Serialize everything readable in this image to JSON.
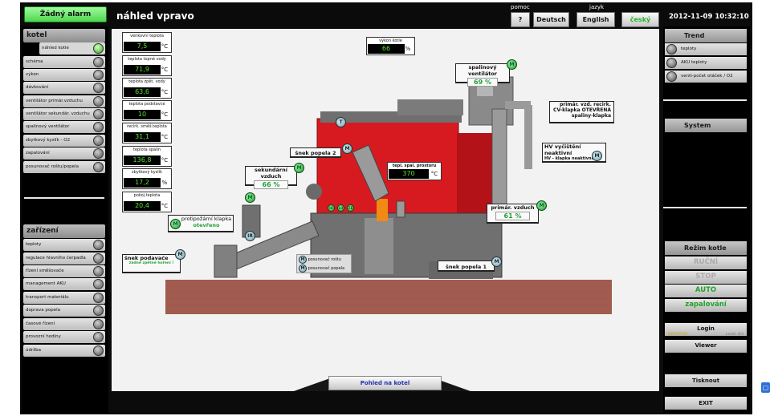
{
  "alarm": "Žádný alarm",
  "page_title": "náhled vpravo",
  "help_label": "pomoc",
  "help_btn": "?",
  "lang_label": "jazyk",
  "langs": [
    "Deutsch",
    "English",
    "český"
  ],
  "datetime": "2012-11-09 10:32:10",
  "kotel": {
    "title": "kotel",
    "items": [
      "náhled kotle",
      "schéma",
      "výkon",
      "dávkování",
      "ventilátor primár.vzduchu",
      "ventilátor sekundár. vzduchu",
      "spalinový ventilátor",
      "zbytkový kyslík - O2",
      "zapalování",
      "posunovač roštu/popela"
    ]
  },
  "zarizeni": {
    "title": "zařízení",
    "items": [
      "teploty",
      "regulace hlavního čerpadla",
      "řízení směšovače",
      "management AKU",
      "transport materiálu",
      "doprava popela",
      "časové řízení",
      "provozní hodiny",
      "údržba"
    ]
  },
  "trend": {
    "title": "Trend",
    "items": [
      "teploty",
      "AKU teploty",
      "venti-počet otáček / O2"
    ]
  },
  "system_title": "System",
  "rezim": {
    "title": "Režim kotle",
    "buttons": [
      "RUČNÍ",
      "STOP",
      "AUTO",
      "zapalování"
    ]
  },
  "login": {
    "login": "Login",
    "user": "OPERATOR",
    "level": "Level: 4/3",
    "viewer": "Viewer"
  },
  "print_btn": "Tisknout",
  "exit_btn": "EXIT",
  "values": [
    {
      "label": "venkovní teplota",
      "value": "7,5",
      "unit": "°C"
    },
    {
      "label": "teplota topné vody",
      "value": "71,9",
      "unit": "°C"
    },
    {
      "label": "teplota zpět. vody",
      "value": "63,6",
      "unit": "°C"
    },
    {
      "label": "teplota podstavce",
      "value": "10",
      "unit": "°C"
    },
    {
      "label": "recirk. směš.teplota",
      "value": "31,1",
      "unit": "°C"
    },
    {
      "label": "teplota spalin",
      "value": "136,8",
      "unit": "°C"
    },
    {
      "label": "zbytkový kyslík",
      "value": "17,2",
      "unit": "%"
    },
    {
      "label": "pokoj.teplota",
      "value": "20,4",
      "unit": "°C"
    }
  ],
  "vykon": {
    "label": "výkon kotle",
    "value": "66",
    "unit": "%"
  },
  "spal_prostor": {
    "label": "tepl. spal. prostoru",
    "value": "370",
    "unit": "°C"
  },
  "spal_vent": {
    "label": "spalinový ventilátor",
    "value": "69 %"
  },
  "sek_vzduch": {
    "label": "sekundární vzduch",
    "value": "66 %"
  },
  "prim_vzduch": {
    "label": "primár. vzduch",
    "value": "61 %"
  },
  "snek2": "šnek popela 2",
  "snek1": "šnek popela 1",
  "recirk": [
    "primár. vzd. recirk.",
    "CV-klapka OTEVŘENÁ",
    "spaliny-klapka"
  ],
  "hv": [
    "HV vyčištění neaktivní",
    "HV - klapka neaktivní"
  ],
  "protipoz": [
    "protipožární klapka",
    "otevřeno"
  ],
  "snek_pod": [
    "šnek podavače",
    "žádné zpětné hoření !"
  ],
  "posun": [
    "posunovač roštu",
    "posunovač popela"
  ],
  "pohled_btn": "Pohled na kotel",
  "m_letter": "M",
  "t_letter": "T",
  "ir_letter": "IR",
  "small_leds": [
    "HI",
    "LO",
    "ZE"
  ],
  "colors": {
    "boiler": "#c4141c",
    "green_led": "#2cad17",
    "value_text": "#57e32e"
  }
}
